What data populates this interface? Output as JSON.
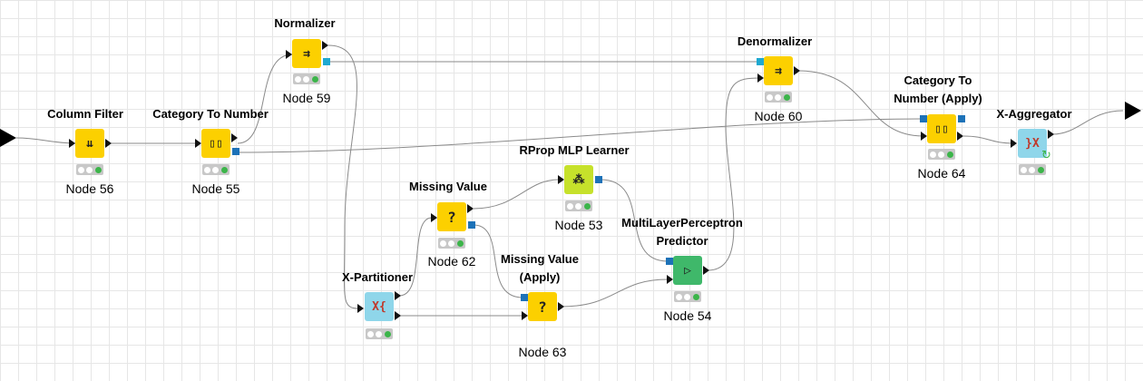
{
  "workflow": {
    "nodes": [
      {
        "title": "Column Filter",
        "label": "Node 56",
        "icon": "⇊"
      },
      {
        "title": "Category To Number",
        "label": "Node 55",
        "icon": "▯▯"
      },
      {
        "title": "Normalizer",
        "label": "Node 59",
        "icon": "⇉"
      },
      {
        "title": "Denormalizer",
        "label": "Node 60",
        "icon": "⇉"
      },
      {
        "title": "Category To",
        "title2": "Number (Apply)",
        "label": "Node 64",
        "icon": "▯▯"
      },
      {
        "title": "X-Aggregator",
        "label": "",
        "icon": "}X"
      },
      {
        "title": "RProp MLP Learner",
        "label": "Node 53",
        "icon": "⁂"
      },
      {
        "title": "Missing Value",
        "label": "Node 62",
        "icon": "?"
      },
      {
        "title": "MultiLayerPerceptron",
        "title2": "Predictor",
        "label": "Node 54",
        "icon": "▷"
      },
      {
        "title": "Missing Value",
        "title2": "(Apply)",
        "label": "Node 63",
        "icon": "?"
      },
      {
        "title": "X-Partitioner",
        "label": "",
        "icon": "X{"
      }
    ],
    "colors": {
      "yellow": "#fcd000",
      "lime": "#c6e12b",
      "cyan": "#8fd6ea",
      "green": "#3fb86a",
      "port_blue": "#1d72b8",
      "status_green": "#3cb54a"
    }
  }
}
